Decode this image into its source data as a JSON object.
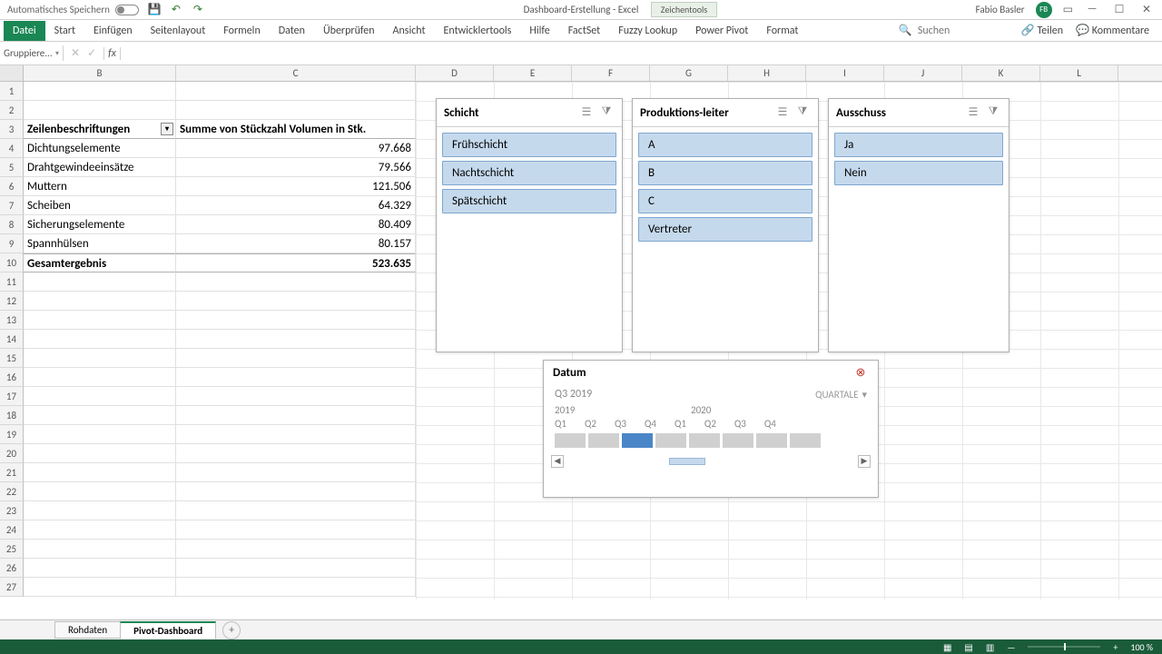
{
  "titlebar": {
    "autosave_label": "Automatisches Speichern",
    "doc_title": "Dashboard-Erstellung  -  Excel",
    "tools_label": "Zeichentools",
    "user_name": "Fabio Basler",
    "user_initials": "FB"
  },
  "ribbon": {
    "tabs": [
      "Datei",
      "Start",
      "Einfügen",
      "Seitenlayout",
      "Formeln",
      "Daten",
      "Überprüfen",
      "Ansicht",
      "Entwicklertools",
      "Hilfe",
      "FactSet",
      "Fuzzy Lookup",
      "Power Pivot",
      "Format"
    ],
    "share": "Teilen",
    "comments": "Kommentare",
    "search_placeholder": "Suchen"
  },
  "namebox": "Gruppiere...",
  "columns": [
    "B",
    "C",
    "D",
    "E",
    "F",
    "G",
    "H",
    "I",
    "J",
    "K",
    "L"
  ],
  "pivot": {
    "header_label": "Zeilenbeschriftungen",
    "header_value": "Summe von Stückzahl Volumen in Stk.",
    "rows": [
      {
        "label": "Dichtungselemente",
        "value": "97.668"
      },
      {
        "label": "Drahtgewindeeinsätze",
        "value": "79.566"
      },
      {
        "label": "Muttern",
        "value": "121.506"
      },
      {
        "label": "Scheiben",
        "value": "64.329"
      },
      {
        "label": "Sicherungselemente",
        "value": "80.409"
      },
      {
        "label": "Spannhülsen",
        "value": "80.157"
      }
    ],
    "total_label": "Gesamtergebnis",
    "total_value": "523.635"
  },
  "slicers": {
    "schicht": {
      "title": "Schicht",
      "items": [
        "Frühschicht",
        "Nachtschicht",
        "Spätschicht"
      ]
    },
    "prod": {
      "title": "Produktions-leiter",
      "items": [
        "A",
        "B",
        "C",
        "Vertreter"
      ]
    },
    "auss": {
      "title": "Ausschuss",
      "items": [
        "Ja",
        "Nein"
      ]
    }
  },
  "timeline": {
    "title": "Datum",
    "period": "Q3 2019",
    "level": "QUARTALE",
    "years": [
      "2019",
      "2020"
    ],
    "quarters": [
      "Q1",
      "Q2",
      "Q3",
      "Q4",
      "Q1",
      "Q2",
      "Q3",
      "Q4"
    ],
    "active_index": 2
  },
  "sheets": [
    "Rohdaten",
    "Pivot-Dashboard"
  ],
  "active_sheet": 1,
  "zoom": "100 %"
}
